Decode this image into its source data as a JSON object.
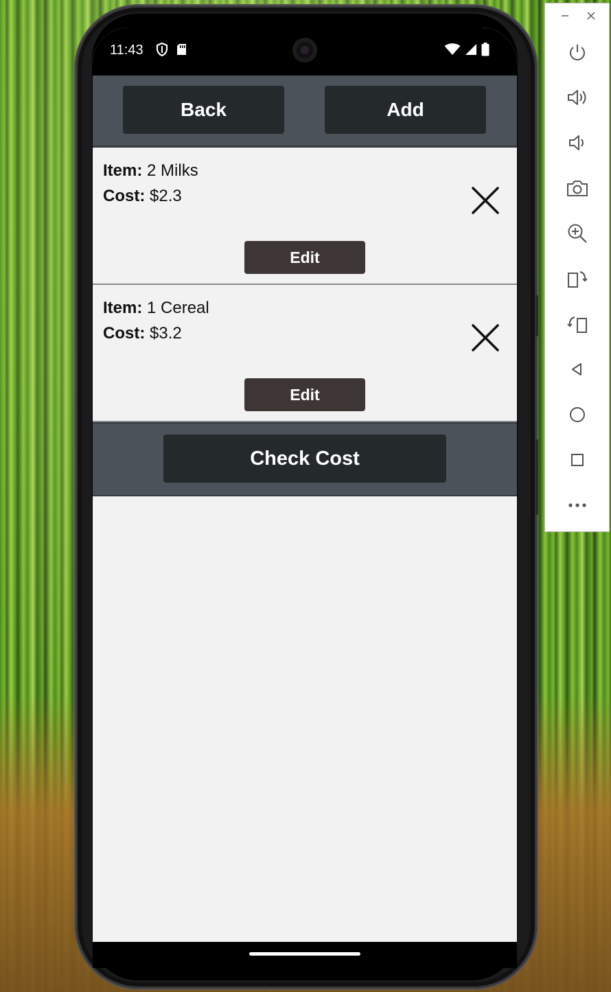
{
  "status_bar": {
    "time": "11:43",
    "left_icons": [
      "shield-icon",
      "sd-card-icon"
    ],
    "right_icons": [
      "wifi-icon",
      "signal-icon",
      "battery-icon"
    ]
  },
  "header": {
    "back_label": "Back",
    "add_label": "Add"
  },
  "items": [
    {
      "item_label": "Item:",
      "item_value": "2 Milks",
      "cost_label": "Cost:",
      "cost_value": "$2.3",
      "edit_label": "Edit"
    },
    {
      "item_label": "Item:",
      "item_value": "1 Cereal",
      "cost_label": "Cost:",
      "cost_value": "$3.2",
      "edit_label": "Edit"
    }
  ],
  "footer": {
    "check_cost_label": "Check Cost"
  },
  "emulator_toolbar": {
    "window_controls": [
      "minimize-icon",
      "close-icon"
    ],
    "buttons": [
      "power-icon",
      "volume-up-icon",
      "volume-down-icon",
      "camera-icon",
      "zoom-icon",
      "rotate-left-icon",
      "rotate-right-icon",
      "back-icon",
      "home-icon",
      "overview-icon",
      "more-icon"
    ]
  },
  "colors": {
    "header_bg": "#4b525a",
    "button_dark": "#242a2c",
    "edit_button": "#3e3635",
    "screen_bg": "#f2f2f2"
  }
}
